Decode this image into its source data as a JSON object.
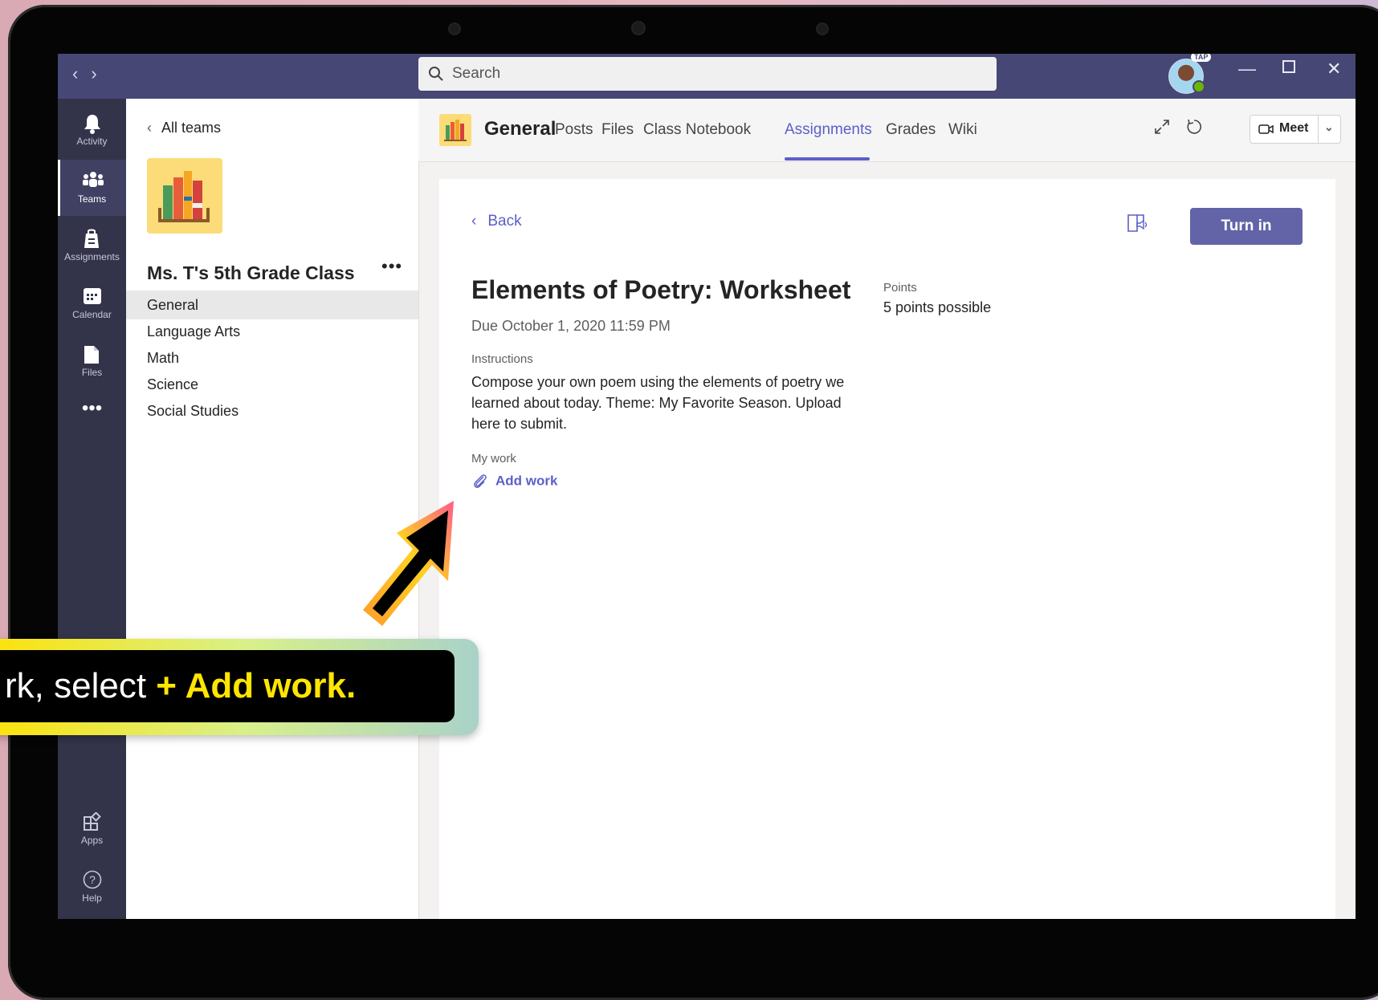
{
  "search": {
    "placeholder": "Search"
  },
  "user": {
    "badge": "TAP"
  },
  "rail": [
    {
      "label": "Activity",
      "icon": "bell-icon"
    },
    {
      "label": "Teams",
      "icon": "teams-icon"
    },
    {
      "label": "Assignments",
      "icon": "assignments-icon"
    },
    {
      "label": "Calendar",
      "icon": "calendar-icon"
    },
    {
      "label": "Files",
      "icon": "files-icon"
    },
    {
      "label": "Apps",
      "icon": "apps-icon"
    },
    {
      "label": "Help",
      "icon": "help-icon"
    }
  ],
  "team": {
    "back_label": "All teams",
    "name": "Ms. T's 5th Grade Class",
    "channels": [
      "General",
      "Language Arts",
      "Math",
      "Science",
      "Social Studies"
    ],
    "selected_channel": "General"
  },
  "header": {
    "channel": "General",
    "tabs": [
      "Posts",
      "Files",
      "Class Notebook",
      "Assignments",
      "Grades",
      "Wiki"
    ],
    "active_tab": "Assignments",
    "meet_label": "Meet"
  },
  "assignment": {
    "back_label": "Back",
    "turn_in_label": "Turn in",
    "title": "Elements of Poetry: Worksheet",
    "due": "Due October 1, 2020 11:59 PM",
    "points_label": "Points",
    "points_value": "5 points possible",
    "instructions_label": "Instructions",
    "instructions": "Compose your own poem using the elements of poetry we learned about today. Theme: My Favorite Season. Upload here to submit.",
    "my_work_label": "My work",
    "add_work_label": "Add work"
  },
  "callout": {
    "prefix": "rk, select ",
    "highlight": "+ Add work."
  },
  "colors": {
    "accent": "#5b5fc7",
    "titlebar": "#464775",
    "rail": "#33344a",
    "turn_in": "#6264a7",
    "callout_highlight": "#ffe600"
  }
}
